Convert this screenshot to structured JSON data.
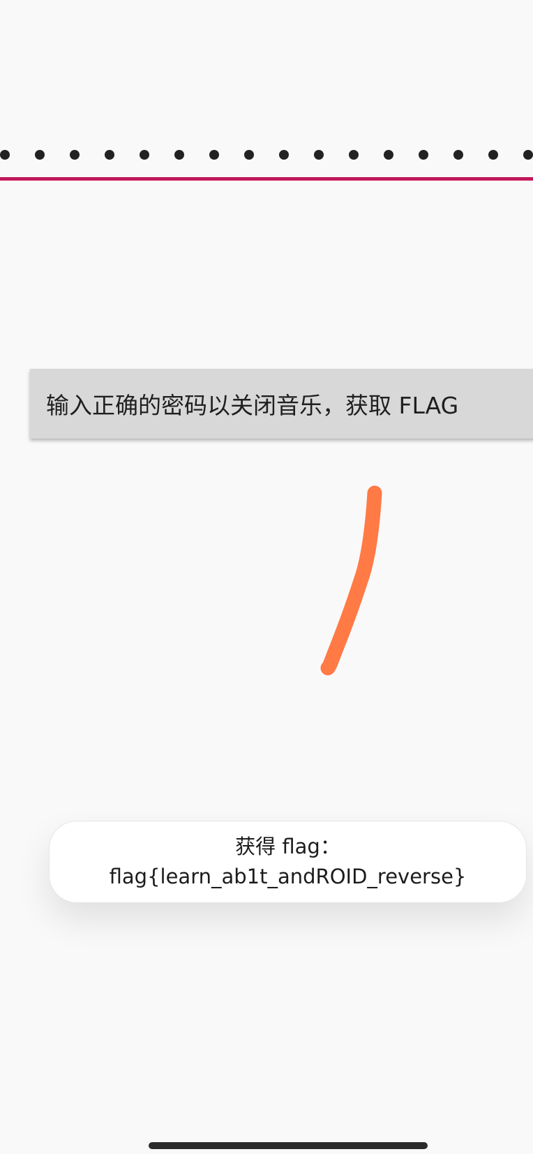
{
  "password": {
    "masked_char_count": 16,
    "underline_color": "#c2185b"
  },
  "submit_button": {
    "label": "输入正确的密码以关闭音乐，获取 FLAG"
  },
  "drawing": {
    "stroke_color": "#ff7a45"
  },
  "toast": {
    "line1": "获得 flag：",
    "line2": "flag{learn_ab1t_andROID_reverse}"
  }
}
